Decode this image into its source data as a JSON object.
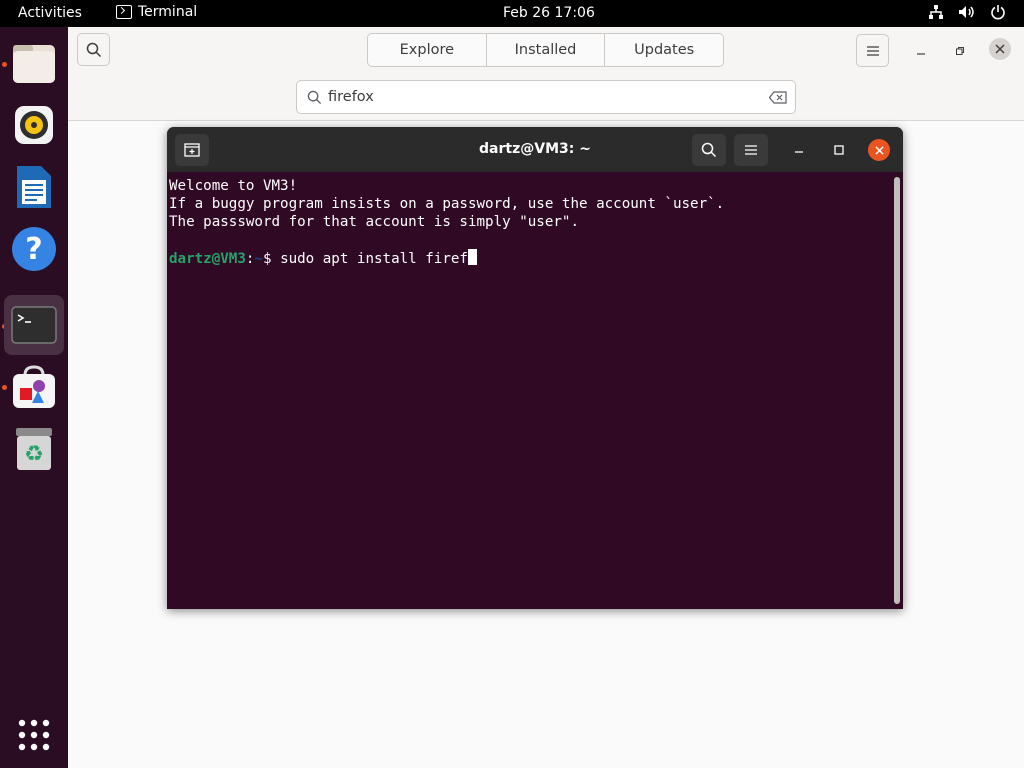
{
  "topbar": {
    "activities": "Activities",
    "app_name": "Terminal",
    "clock": "Feb 26  17:06"
  },
  "dock": {
    "items": [
      {
        "name": "files",
        "running": true
      },
      {
        "name": "rhythmbox",
        "running": false
      },
      {
        "name": "libreoffice-writer",
        "running": false
      },
      {
        "name": "help",
        "running": false
      },
      {
        "name": "terminal",
        "running": true,
        "active": true
      },
      {
        "name": "ubuntu-software",
        "running": true
      },
      {
        "name": "trash",
        "running": false
      }
    ],
    "show_apps": "show-apps"
  },
  "software": {
    "tabs": [
      "Explore",
      "Installed",
      "Updates"
    ],
    "search_value": "firefox"
  },
  "terminal": {
    "title": "dartz@VM3: ~",
    "lines": [
      "Welcome to VM3!",
      "If a buggy program insists on a password, use the account `user`.",
      "The passsword for that account is simply \"user\"."
    ],
    "prompt_user": "dartz@VM3",
    "prompt_path": "~",
    "prompt_sep": ":",
    "prompt_symbol": "$",
    "command": "sudo apt install firef"
  },
  "colors": {
    "terminal_bg": "#300a24",
    "prompt_user": "#26a269",
    "prompt_path": "#12488b",
    "accent": "#e95420"
  }
}
